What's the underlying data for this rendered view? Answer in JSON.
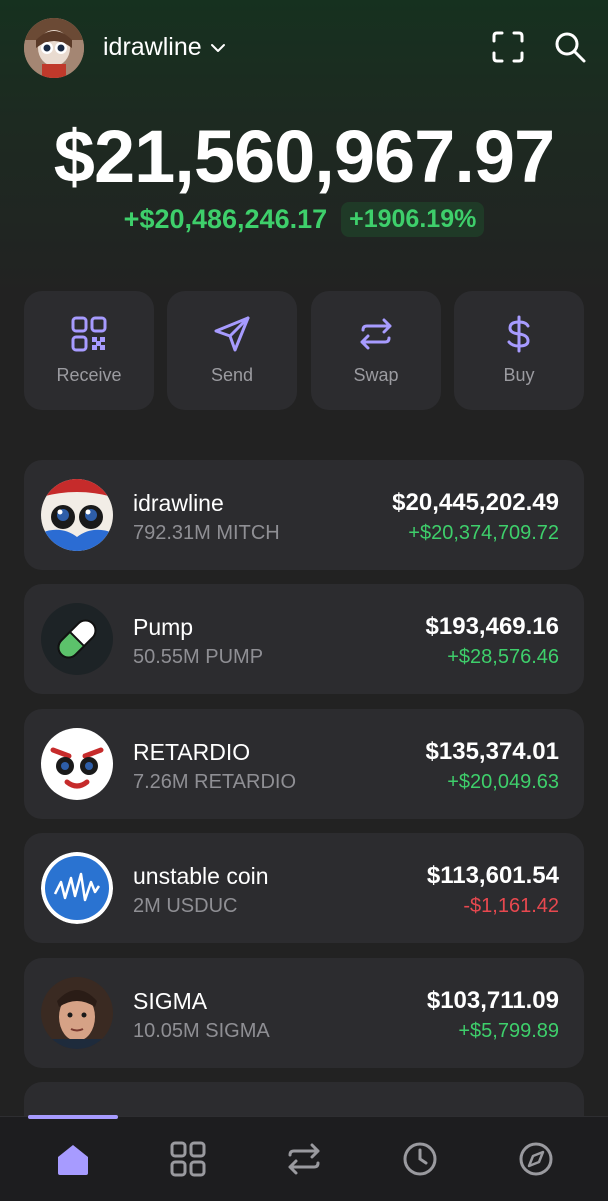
{
  "header": {
    "username": "idrawline",
    "icons": [
      "avatar",
      "chevron-down-icon",
      "scan-icon",
      "search-icon"
    ]
  },
  "portfolio": {
    "balance": "$21,560,967.97",
    "change_abs": "+$20,486,246.17",
    "change_pct": "+1906.19%"
  },
  "actions": [
    {
      "label": "Receive",
      "icon": "qr-code-icon"
    },
    {
      "label": "Send",
      "icon": "send-icon"
    },
    {
      "label": "Swap",
      "icon": "swap-icon"
    },
    {
      "label": "Buy",
      "icon": "dollar-icon"
    }
  ],
  "tokens": [
    {
      "name": "idrawline",
      "qty": "792.31M MITCH",
      "value": "$20,445,202.49",
      "change": "+$20,374,709.72",
      "direction": "up"
    },
    {
      "name": "Pump",
      "qty": "50.55M PUMP",
      "value": "$193,469.16",
      "change": "+$28,576.46",
      "direction": "up"
    },
    {
      "name": "RETARDIO",
      "qty": "7.26M RETARDIO",
      "value": "$135,374.01",
      "change": "+$20,049.63",
      "direction": "up"
    },
    {
      "name": "unstable coin",
      "qty": "2M USDUC",
      "value": "$113,601.54",
      "change": "-$1,161.42",
      "direction": "down"
    },
    {
      "name": "SIGMA",
      "qty": "10.05M SIGMA",
      "value": "$103,711.09",
      "change": "+$5,799.89",
      "direction": "up"
    }
  ],
  "tabs": [
    "home-icon",
    "collectibles-icon",
    "swap-tab-icon",
    "history-icon",
    "explore-icon"
  ],
  "colors": {
    "accent": "#a79bff",
    "positive": "#3ecf6b",
    "negative": "#e8484f",
    "card": "#2c2c2f",
    "background": "#222222"
  }
}
